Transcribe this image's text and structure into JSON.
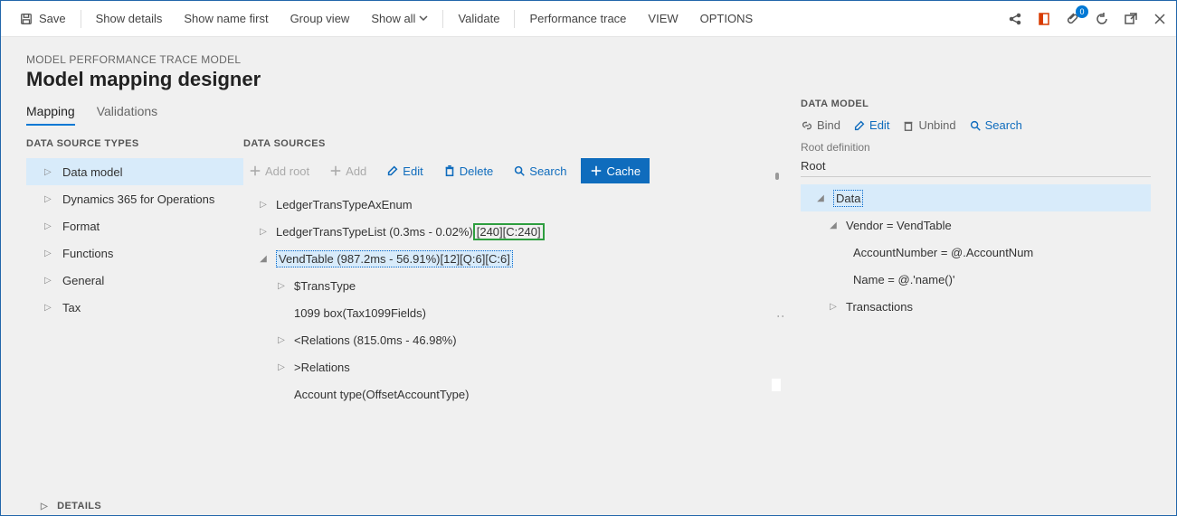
{
  "toolbar": {
    "save": "Save",
    "show_details": "Show details",
    "show_name_first": "Show name first",
    "group_view": "Group view",
    "show_all": "Show all",
    "validate": "Validate",
    "perf_trace": "Performance trace",
    "view": "VIEW",
    "options": "OPTIONS",
    "badge_count": "0"
  },
  "breadcrumb": "MODEL PERFORMANCE TRACE MODEL",
  "page_title": "Model mapping designer",
  "tabs": {
    "mapping": "Mapping",
    "validations": "Validations"
  },
  "columns": {
    "types_hdr": "DATA SOURCE TYPES",
    "sources_hdr": "DATA SOURCES"
  },
  "types": [
    {
      "label": "Data model",
      "selected": true
    },
    {
      "label": "Dynamics 365 for Operations"
    },
    {
      "label": "Format"
    },
    {
      "label": "Functions"
    },
    {
      "label": "General"
    },
    {
      "label": "Tax"
    }
  ],
  "src_toolbar": {
    "add_root": "Add root",
    "add": "Add",
    "edit": "Edit",
    "delete": "Delete",
    "search": "Search",
    "cache": "Cache"
  },
  "sources_tree": {
    "r0": "LedgerTransTypeAxEnum",
    "r1a": "LedgerTransTypeList (0.3ms - 0.02%)",
    "r1b": "[240][C:240]",
    "r2": "VendTable (987.2ms - 56.91%)[12][Q:6][C:6]",
    "r3": "$TransType",
    "r4": "1099 box(Tax1099Fields)",
    "r5": "<Relations (815.0ms - 46.98%)",
    "r6": ">Relations",
    "r7": "Account type(OffsetAccountType)"
  },
  "right": {
    "hdr": "DATA MODEL",
    "bind": "Bind",
    "edit": "Edit",
    "unbind": "Unbind",
    "search": "Search",
    "rootdef_lbl": "Root definition",
    "rootdef_val": "Root",
    "t0": "Data",
    "t1": "Vendor = VendTable",
    "t2": "AccountNumber = @.AccountNum",
    "t3": "Name = @.'name()'",
    "t4": "Transactions"
  },
  "details": "DETAILS"
}
